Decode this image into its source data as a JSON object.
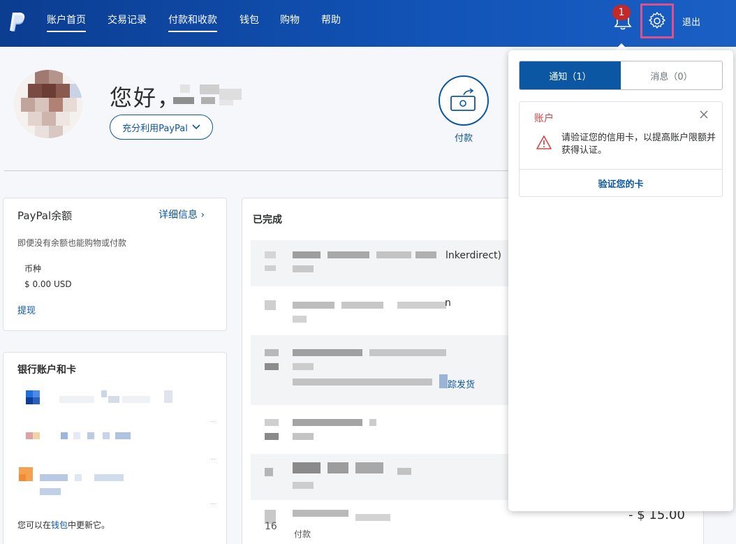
{
  "nav": {
    "items": [
      {
        "label": "账户首页",
        "active": true
      },
      {
        "label": "交易记录",
        "active": false
      },
      {
        "label": "付款和收款",
        "active": true
      },
      {
        "label": "钱包",
        "active": false
      },
      {
        "label": "购物",
        "active": false
      },
      {
        "label": "帮助",
        "active": false
      }
    ],
    "notification_count": "1",
    "logout_label": "退出"
  },
  "hero": {
    "greeting": "您好，",
    "leverage_button": "充分利用PayPal",
    "pay_label": "付款"
  },
  "balance": {
    "title": "PayPal余额",
    "details_link": "详细信息 ›",
    "subtitle": "即便没有余额也能购物或付款",
    "currency_heading": "币种",
    "currency_value": "$ 0.00 USD",
    "withdraw_link": "提现"
  },
  "bank": {
    "title": "银行账户和卡",
    "footer_prefix": "您可以在",
    "footer_link": "钱包",
    "footer_suffix": "中更新它。"
  },
  "activity": {
    "title": "已完成",
    "rows": [
      {
        "visible_text": "lnkerdirect)"
      },
      {
        "visible_text": "n"
      },
      {
        "visible_text": "踪发货"
      },
      {
        "visible_text": ""
      },
      {
        "visible_text": ""
      },
      {
        "visible_text": "付款",
        "date_fragment": "16"
      }
    ],
    "last_amount": "- $ 15.00"
  },
  "notifications": {
    "tab_notices": "通知（1）",
    "tab_messages": "消息（0）",
    "card": {
      "heading": "账户",
      "body": "请验证您的信用卡，以提高账户限额并获得认证。",
      "action": "验证您的卡"
    }
  },
  "colors": {
    "header": "#0b3d91",
    "accent": "#0b57a4",
    "badge": "#c62828",
    "gear_highlight": "#e0518b",
    "warning": "#d64545"
  }
}
